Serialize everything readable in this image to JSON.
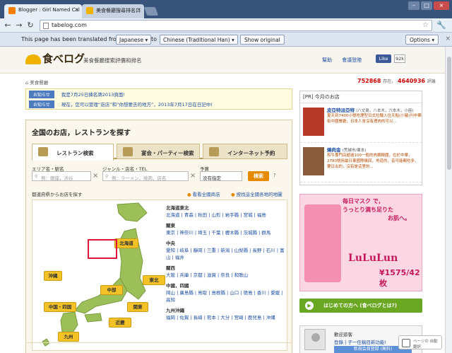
{
  "browser": {
    "tabs": [
      {
        "title": "Blogger : Girl Named Cal",
        "icon": "blogger-icon",
        "color": "#f57d00"
      },
      {
        "title": "美食餐廳搜尋排名口",
        "icon": "tabelog-icon",
        "color": "#f0b400"
      }
    ],
    "url": "tabelog.com",
    "back": "←",
    "forward": "→",
    "reload": "↻",
    "translate_bar": {
      "prefix": "This page has been translated from",
      "from_lang": "Japanese ▾",
      "to": "to",
      "to_lang": "Chinese (Traditional Han) ▾",
      "show_original": "Show original",
      "options": "Options ▾",
      "close": "×"
    },
    "new_badge": "NEW"
  },
  "site": {
    "logo": "食べログ",
    "tagline": "美食餐廳搜索評價和排名",
    "header_links": [
      "幫助",
      "會議登陸"
    ],
    "fb_like": "Like",
    "fb_count": "92k",
    "breadcrumb": "美食餐廳",
    "count_restaurants": "752868",
    "count_label_1": "存在，",
    "count_reviews": "4640936",
    "count_label_2": "評論"
  },
  "notices": [
    {
      "label": "お知らせ",
      "text": "我是7月25日揀名牌2013頁面!"
    },
    {
      "label": "お知らせ",
      "text": "現在，您可以管理“店店”和“你想要去的地方”，2013年7月17日在日記中!"
    }
  ],
  "search": {
    "title": "全国のお店，レストランを探す",
    "tabs": [
      "レストラン検索",
      "宴会・パーティー検索",
      "インターネット予約"
    ],
    "field_labels": [
      "エリア名・駅名",
      "ジャンル・店名・TEL",
      "予算"
    ],
    "area_placeholder": "例：銀座，渋谷",
    "genre_placeholder": "例：ラーメン，焼肉，店名",
    "budget_value": "没有指定",
    "search_button": "検索",
    "help": "?",
    "pref_label": "都道府県からお店を探す",
    "link1": "看看全國商店",
    "link2": "按找這全國各地的地圖",
    "regions": [
      "北海道",
      "沖縄",
      "東北",
      "中部",
      "中国・四国",
      "関東",
      "近畿",
      "四西",
      "九州"
    ],
    "areas": [
      {
        "name": "北海道東北",
        "cities": "北海道 | 青森 | 秋田 | 山形 | 岩手縣 | 宮城 | 福島"
      },
      {
        "name": "關東",
        "cities": "東京 | 神奈川 | 埼玉 | 千葉 | 櫪木縣 | 茨城縣 | 群馬"
      },
      {
        "name": "中央",
        "cities": "愛知 | 岐阜 | 靜岡 | 三重 | 新潟 | 山梨縣 | 長野 | 石川 | 富山 | 福井"
      },
      {
        "name": "關西",
        "cities": "大阪 | 兵庫 | 京都 | 滋賀 | 奈良 | 和歌山"
      },
      {
        "name": "中國，四國",
        "cities": "岡山 | 廣島縣 | 鳥取 | 島根縣 | 山口 | 德島 | 香川 | 愛媛 | 高知"
      },
      {
        "name": "九州沖繩",
        "cities": "福岡 | 佐賀 | 長崎 | 熊本 | 大分 | 宮崎 | 鹿兒島 | 沖縄"
      }
    ]
  },
  "sidebar": {
    "pr_title": "[PR] 今月のお店",
    "pr_items": [
      {
        "name": "皮亞特派亞特",
        "area": "(八丈島，八本木，六本木，小座)",
        "desc": "夏天到7400小號吃理型日式拉麵入住天點(小豬)刊中華街中國餐廳，日本人會沒有理肉的可以..."
      },
      {
        "name": "燒肉金",
        "area": "(荒城市/東本)",
        "desc": "和牛專門店超過100一般的肉類韓國，位於中華，2780號用最日東國際幾回，地道的，音可能都吃多，要日出的，沒有是這里的..."
      }
    ],
    "ad": {
      "line1": "毎日マスク で，",
      "line2": "うっとり満ち足りた",
      "line3": "お肌へ。",
      "brand": "LuLuLun",
      "price": "¥1575/42枚"
    },
    "start_button": "はじめての方へ (食べログとは?)",
    "welcome": "歡迎遊客",
    "login": "登錄 | 子一任稿目新功能!",
    "register": "新規会員登録 (無料)"
  },
  "page_translate": "ページの 自動翻訳"
}
